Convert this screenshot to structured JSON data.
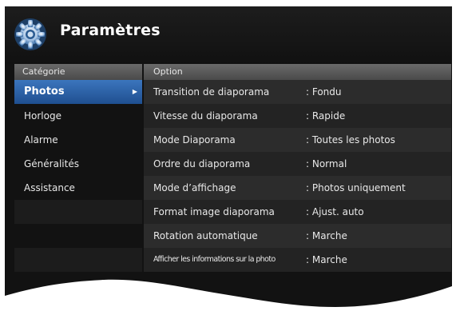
{
  "header": {
    "title": "Paramètres",
    "icon": "settings-gear-icon"
  },
  "columns": {
    "category": "Catégorie",
    "option": "Option"
  },
  "categories": [
    {
      "label": "Photos",
      "selected": true
    },
    {
      "label": "Horloge",
      "selected": false
    },
    {
      "label": "Alarme",
      "selected": false
    },
    {
      "label": "Généralités",
      "selected": false
    },
    {
      "label": "Assistance",
      "selected": false
    }
  ],
  "options": [
    {
      "label": "Transition de diaporama",
      "value": ": Fondu"
    },
    {
      "label": "Vitesse du diaporama",
      "value": ": Rapide"
    },
    {
      "label": "Mode Diaporama",
      "value": ": Toutes les photos"
    },
    {
      "label": "Ordre du diaporama",
      "value": ": Normal"
    },
    {
      "label": "Mode d’affichage",
      "value": ": Photos uniquement"
    },
    {
      "label": "Format image diaporama",
      "value": ": Ajust. auto"
    },
    {
      "label": "Rotation automatique",
      "value": ": Marche"
    },
    {
      "label": "Afficher les informations sur la photo",
      "value": ": Marche"
    }
  ],
  "colors": {
    "accent": "#2f65ad",
    "background": "#121212",
    "header_bar": "#5a5a5a"
  }
}
